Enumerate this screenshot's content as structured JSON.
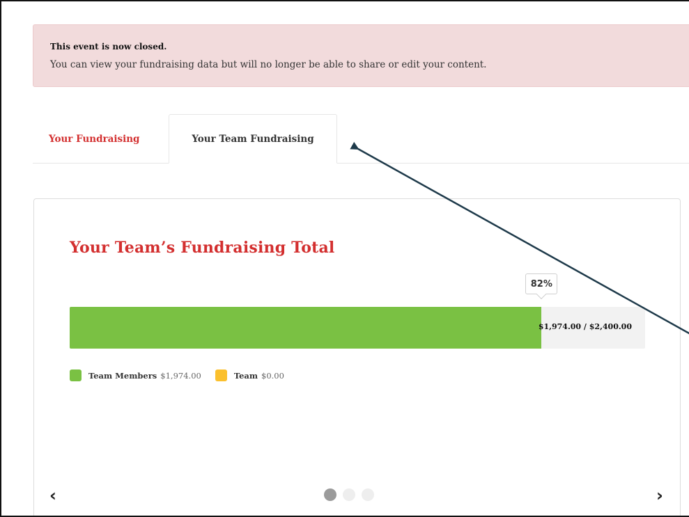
{
  "alert": {
    "title": "This event is now closed.",
    "message": "You can view your fundraising data but will no longer be able to share or edit your content."
  },
  "tabs": [
    {
      "label": "Your Fundraising",
      "active": false
    },
    {
      "label": "Your Team Fundraising",
      "active": true
    }
  ],
  "card": {
    "title": "Your Team’s Fundraising Total",
    "progress": {
      "percent_label": "82%",
      "percent": 82,
      "raised_text": "$1,974.00 / $2,400.00"
    },
    "legend": [
      {
        "name": "Team Members",
        "value": "$1,974.00",
        "color": "#7ac143"
      },
      {
        "name": "Team",
        "value": "$0.00",
        "color": "#fbc02d"
      }
    ],
    "carousel": {
      "prev_icon": "‹",
      "next_icon": "›",
      "active_index": 0,
      "slide_count": 3
    }
  },
  "colors": {
    "brand_red": "#d32f2f",
    "progress_green": "#7ac143",
    "alert_bg": "#f2dbdc",
    "annotation_arrow": "#1e3a4a"
  }
}
